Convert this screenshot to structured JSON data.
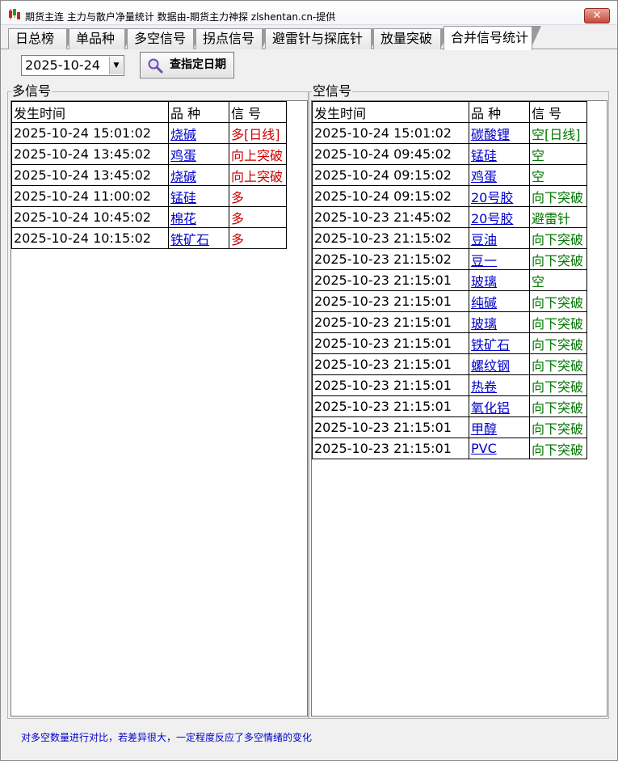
{
  "window": {
    "title": "期货主连 主力与散户净量统计 数据由-期货主力神探 zlshentan.cn-提供",
    "close_symbol": "✕"
  },
  "tabs": [
    {
      "label": "日总榜"
    },
    {
      "label": "单品种"
    },
    {
      "label": "多空信号"
    },
    {
      "label": "拐点信号"
    },
    {
      "label": "避雷针与探底针"
    },
    {
      "label": "放量突破"
    },
    {
      "label": "合并信号统计"
    }
  ],
  "toolbar": {
    "date_value": "2025-10-24",
    "query_label": "查指定日期"
  },
  "long_panel": {
    "title": "多信号",
    "headers": {
      "time": "发生时间",
      "product": "品  种",
      "signal": "信  号"
    },
    "rows": [
      {
        "time": "2025-10-24 15:01:02",
        "product": "烧碱",
        "signal": "多[日线]"
      },
      {
        "time": "2025-10-24 13:45:02",
        "product": "鸡蛋",
        "signal": "向上突破"
      },
      {
        "time": "2025-10-24 13:45:02",
        "product": "烧碱",
        "signal": "向上突破"
      },
      {
        "time": "2025-10-24 11:00:02",
        "product": "锰硅",
        "signal": "多"
      },
      {
        "time": "2025-10-24 10:45:02",
        "product": "棉花",
        "signal": "多"
      },
      {
        "time": "2025-10-24 10:15:02",
        "product": "铁矿石",
        "signal": "多"
      }
    ]
  },
  "short_panel": {
    "title": "空信号",
    "headers": {
      "time": "发生时间",
      "product": "品  种",
      "signal": "信  号"
    },
    "rows": [
      {
        "time": "2025-10-24 15:01:02",
        "product": "碳酸锂",
        "signal": "空[日线]"
      },
      {
        "time": "2025-10-24 09:45:02",
        "product": "锰硅",
        "signal": "空"
      },
      {
        "time": "2025-10-24 09:15:02",
        "product": "鸡蛋",
        "signal": "空"
      },
      {
        "time": "2025-10-24 09:15:02",
        "product": "20号胶",
        "signal": "向下突破"
      },
      {
        "time": "2025-10-23 21:45:02",
        "product": "20号胶",
        "signal": "避雷针"
      },
      {
        "time": "2025-10-23 21:15:02",
        "product": "豆油",
        "signal": "向下突破"
      },
      {
        "time": "2025-10-23 21:15:02",
        "product": "豆一",
        "signal": "向下突破"
      },
      {
        "time": "2025-10-23 21:15:01",
        "product": "玻璃",
        "signal": "空"
      },
      {
        "time": "2025-10-23 21:15:01",
        "product": "纯碱",
        "signal": "向下突破"
      },
      {
        "time": "2025-10-23 21:15:01",
        "product": "玻璃",
        "signal": "向下突破"
      },
      {
        "time": "2025-10-23 21:15:01",
        "product": "铁矿石",
        "signal": "向下突破"
      },
      {
        "time": "2025-10-23 21:15:01",
        "product": "螺纹钢",
        "signal": "向下突破"
      },
      {
        "time": "2025-10-23 21:15:01",
        "product": "热卷",
        "signal": "向下突破"
      },
      {
        "time": "2025-10-23 21:15:01",
        "product": "氧化铝",
        "signal": "向下突破"
      },
      {
        "time": "2025-10-23 21:15:01",
        "product": "甲醇",
        "signal": "向下突破"
      },
      {
        "time": "2025-10-23 21:15:01",
        "product": "PVC",
        "signal": "向下突破"
      }
    ]
  },
  "footer": {
    "note": "对多空数量进行对比，若差异很大，一定程度反应了多空情绪的变化"
  },
  "colors": {
    "long_signal": "#cc0000",
    "short_signal": "#007700",
    "link": "#0000cc"
  }
}
